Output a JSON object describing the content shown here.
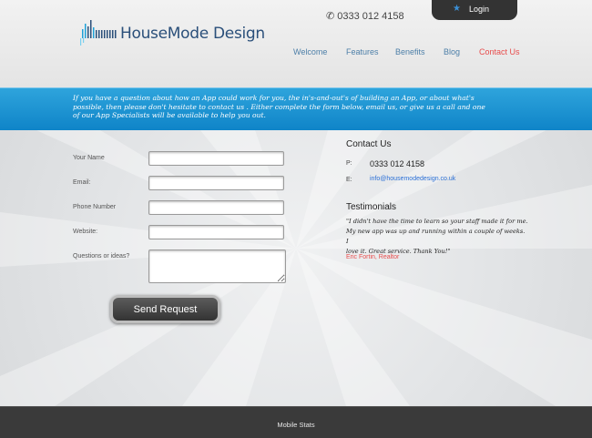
{
  "header": {
    "logo_text": "HouseMode Design",
    "phone": "0333 012 4158",
    "login_label": "Login",
    "nav": [
      {
        "label": "Welcome"
      },
      {
        "label": "Features"
      },
      {
        "label": "Benefits"
      },
      {
        "label": "Blog"
      },
      {
        "label": "Contact Us",
        "active": true
      }
    ]
  },
  "intro": {
    "line1": "If you have a question about how an App could work for you, the in's-and-out's of building an App, or about what's",
    "line2": "possible, then please don't hesitate to contact us . Either complete the form below, email us, or give us a call and one",
    "line3": "of our App Specialists will be available to help you out."
  },
  "form": {
    "name_label": "Your Name",
    "email_label": "Email:",
    "phone_label": "Phone Number",
    "website_label": "Website:",
    "questions_label": "Questions or ideas?",
    "name_value": "",
    "email_value": "",
    "phone_value": "",
    "website_value": "",
    "questions_value": "",
    "send_label": "Send Request"
  },
  "contact": {
    "heading": "Contact Us",
    "phone_key": "P:",
    "phone_value": "0333 012 4158",
    "email_key": "E:",
    "email_value": "info@housemodedesign.co.uk"
  },
  "testimonials": {
    "heading": "Testimonials",
    "quote_line1": "\"I didn't have the time to learn so your staff made it for me.",
    "quote_line2": "My new app was up and running within a couple of weeks. I",
    "quote_line3": "love it. Great service. Thank You!\"",
    "author": "Eric Fortin, Realtor"
  },
  "footer": {
    "text": "Mobile Stats"
  },
  "colors": {
    "band": "#1b92d2",
    "nav": "#4d7fa8",
    "active_nav": "#e84c4c",
    "link": "#2a6fd6",
    "footer": "#3a3a3a"
  },
  "icons": [
    "logo-bars-icon",
    "phone-icon",
    "star-icon",
    "resize-grip-icon"
  ]
}
